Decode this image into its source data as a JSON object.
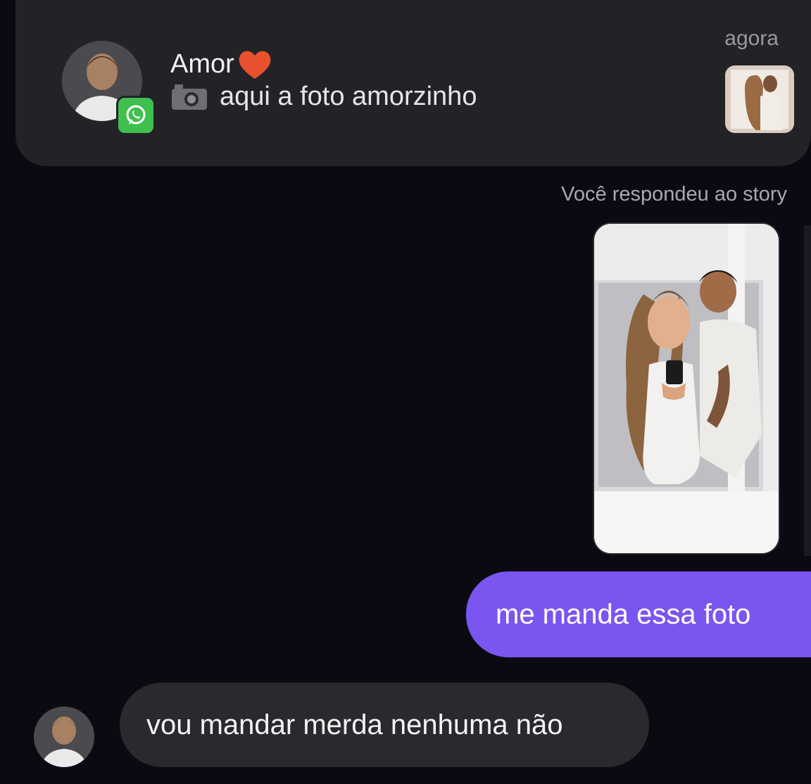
{
  "notification": {
    "sender": "Amor",
    "message": "aqui a foto amorzinho",
    "time": "agora"
  },
  "story_reply_note": "Você respondeu ao story",
  "messages": {
    "outgoing": "me manda essa foto",
    "incoming": "vou mandar merda nenhuma não"
  },
  "colors": {
    "background": "#0b0a12",
    "banner": "#232227",
    "outgoing_bubble": "#7a55ef",
    "incoming_bubble": "#2a292e",
    "whatsapp": "#3fbf4e"
  },
  "icons": [
    "whatsapp-icon",
    "heart-icon",
    "camera-icon"
  ]
}
